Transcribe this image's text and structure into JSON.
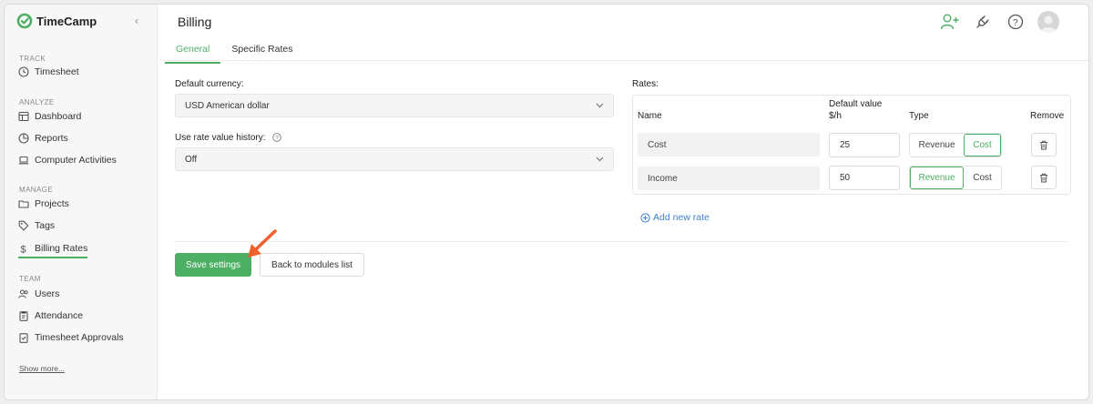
{
  "app": {
    "logo_text": "TimeCamp"
  },
  "sidebar": {
    "sections": {
      "track": "TRACK",
      "analyze": "ANALYZE",
      "manage": "MANAGE",
      "team": "TEAM"
    },
    "items": {
      "timesheet": "Timesheet",
      "dashboard": "Dashboard",
      "reports": "Reports",
      "computer_activities": "Computer Activities",
      "projects": "Projects",
      "tags": "Tags",
      "billing_rates": "Billing Rates",
      "users": "Users",
      "attendance": "Attendance",
      "timesheet_approvals": "Timesheet Approvals"
    },
    "show_more": "Show more..."
  },
  "header": {
    "title": "Billing"
  },
  "tabs": [
    {
      "label": "General",
      "active": true
    },
    {
      "label": "Specific Rates",
      "active": false
    }
  ],
  "form": {
    "currency_label": "Default currency:",
    "currency_value": "USD American dollar",
    "history_label": "Use rate value history:",
    "history_value": "Off"
  },
  "rates": {
    "label": "Rates:",
    "columns": {
      "name": "Name",
      "default_value_line1": "Default value",
      "default_value_line2": "$/h",
      "type": "Type",
      "remove": "Remove"
    },
    "type_options": {
      "revenue": "Revenue",
      "cost": "Cost"
    },
    "rows": [
      {
        "name": "Cost",
        "value": "25",
        "selected_type": "Cost"
      },
      {
        "name": "Income",
        "value": "50",
        "selected_type": "Revenue"
      }
    ],
    "add_label": "Add new rate"
  },
  "actions": {
    "save": "Save settings",
    "back": "Back to modules list"
  },
  "colors": {
    "accent": "#4caf63",
    "link": "#3c7fd0",
    "annotation_arrow": "#f0612d"
  }
}
